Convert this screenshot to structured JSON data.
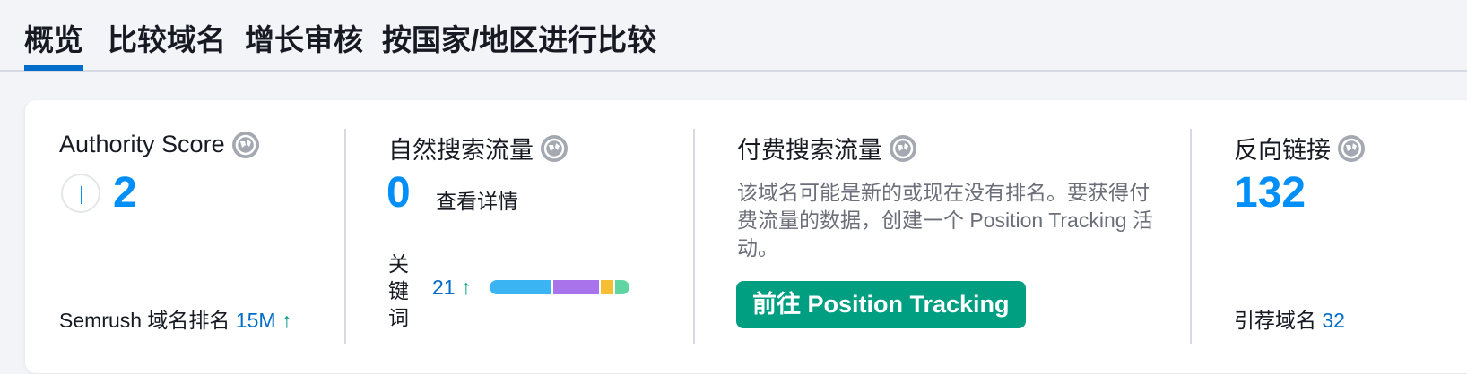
{
  "tabs": [
    {
      "label": "概览",
      "active": true
    },
    {
      "label": "比较域名",
      "active": false
    },
    {
      "label": "增长审核",
      "active": false
    },
    {
      "label": "按国家/地区进行比较",
      "active": false
    }
  ],
  "authority": {
    "title": "Authority Score",
    "value": "2",
    "rank_label": "Semrush 域名排名",
    "rank_value": "15M",
    "rank_arrow": "↑"
  },
  "organic": {
    "title": "自然搜索流量",
    "value": "0",
    "details_link": "查看详情",
    "keywords_label": "关键词",
    "keywords_value": "21",
    "keywords_arrow": "↑",
    "keyword_bar_colors": [
      "#3ab4f2",
      "#a973eb",
      "#f6bf33",
      "#5fd6a2"
    ],
    "keyword_bar_fractions": [
      0.46,
      0.34,
      0.09,
      0.11
    ]
  },
  "paid": {
    "title": "付费搜索流量",
    "description": "该域名可能是新的或现在没有排名。要获得付费流量的数据，创建一个 Position Tracking 活动。",
    "button_label": "前往 Position Tracking"
  },
  "backlinks": {
    "title": "反向链接",
    "value": "132",
    "referring_label": "引荐域名",
    "referring_value": "32"
  },
  "colors": {
    "accent_blue": "#008ff8",
    "link_blue": "#006dca",
    "green": "#009f81",
    "icon_gray": "#a4a8b0"
  }
}
